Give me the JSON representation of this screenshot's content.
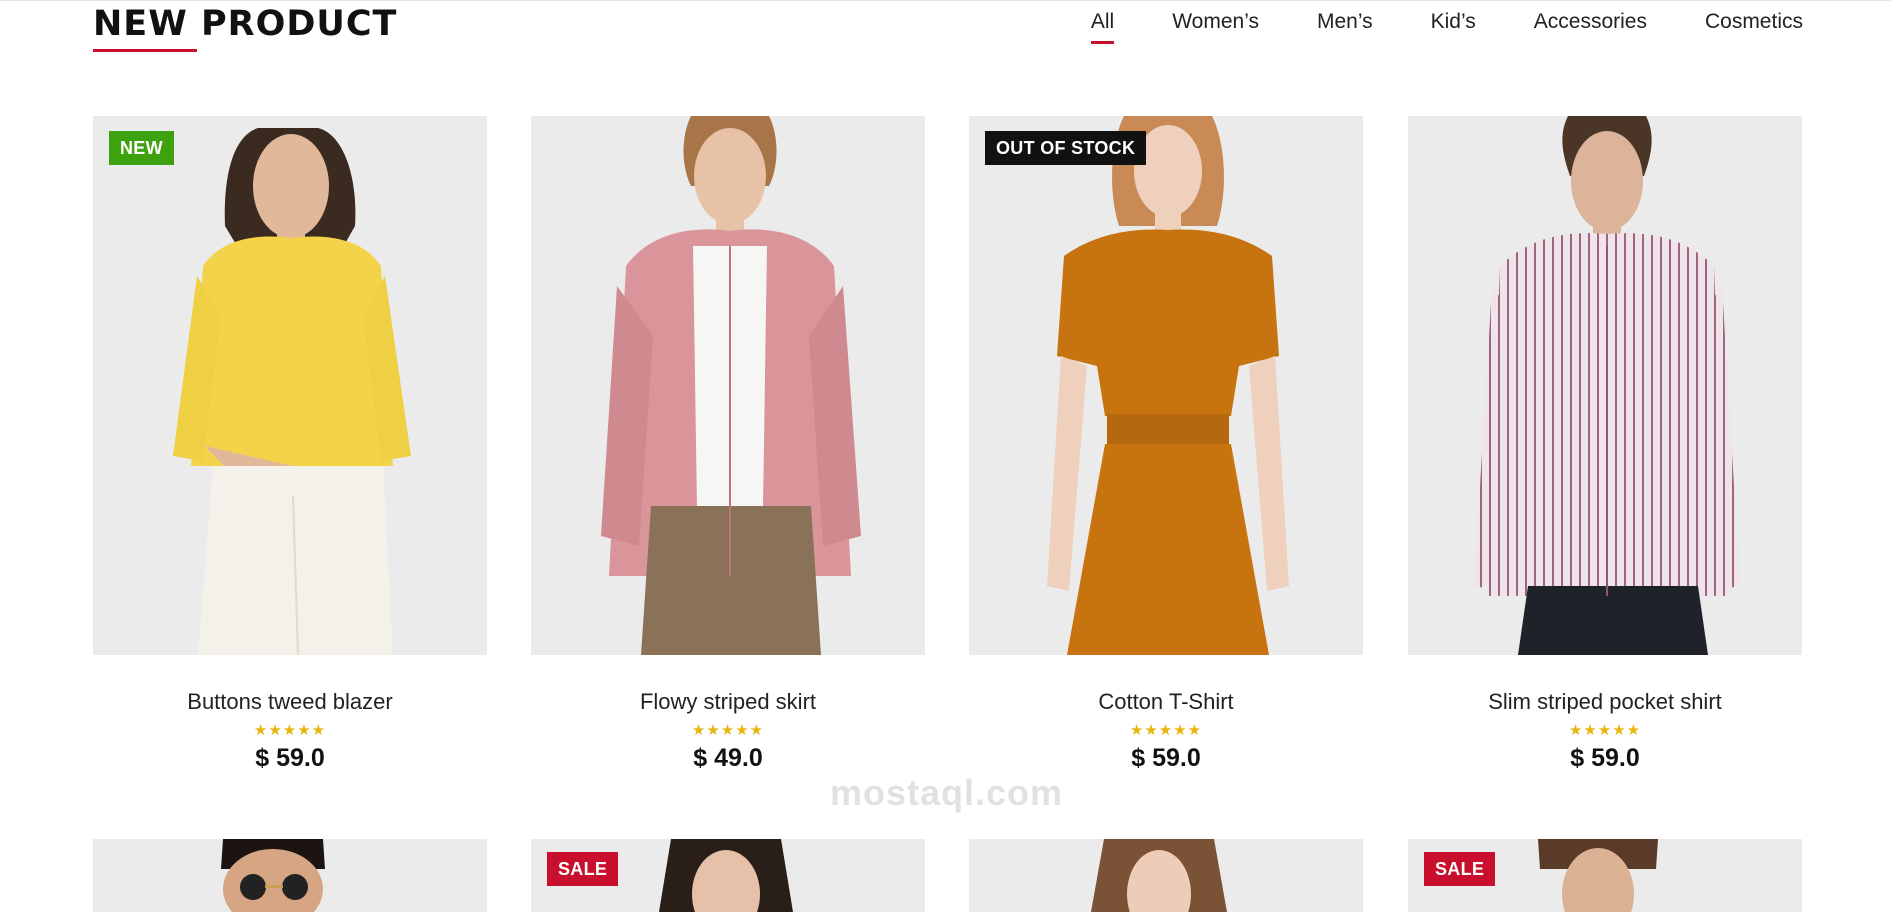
{
  "section": {
    "title": "NEW PRODUCT"
  },
  "filters": [
    "All",
    "Women’s",
    "Men’s",
    "Kid’s",
    "Accessories",
    "Cosmetics"
  ],
  "products": [
    {
      "name": "Buttons tweed blazer",
      "price": "$ 59.0",
      "badge": "NEW",
      "stars": "★★★★★",
      "rating": 5
    },
    {
      "name": "Flowy striped skirt",
      "price": "$ 49.0",
      "badge": "",
      "stars": "★★★★★",
      "rating": 5
    },
    {
      "name": "Cotton T-Shirt",
      "price": "$ 59.0",
      "badge": "OUT OF STOCK",
      "stars": "★★★★★",
      "rating": 5
    },
    {
      "name": "Slim striped pocket shirt",
      "price": "$ 59.0",
      "badge": "",
      "stars": "★★★★★",
      "rating": 5
    }
  ],
  "row2_badges": [
    "",
    "SALE",
    "",
    "SALE"
  ],
  "watermark": "mostaql.com",
  "colors": {
    "accent": "#c8102e",
    "badge_new": "#3ea20f",
    "badge_out_of_stock": "#111111",
    "badge_sale": "#c8102e",
    "stars": "#e8b50f",
    "image_bg": "#ebebeb"
  }
}
